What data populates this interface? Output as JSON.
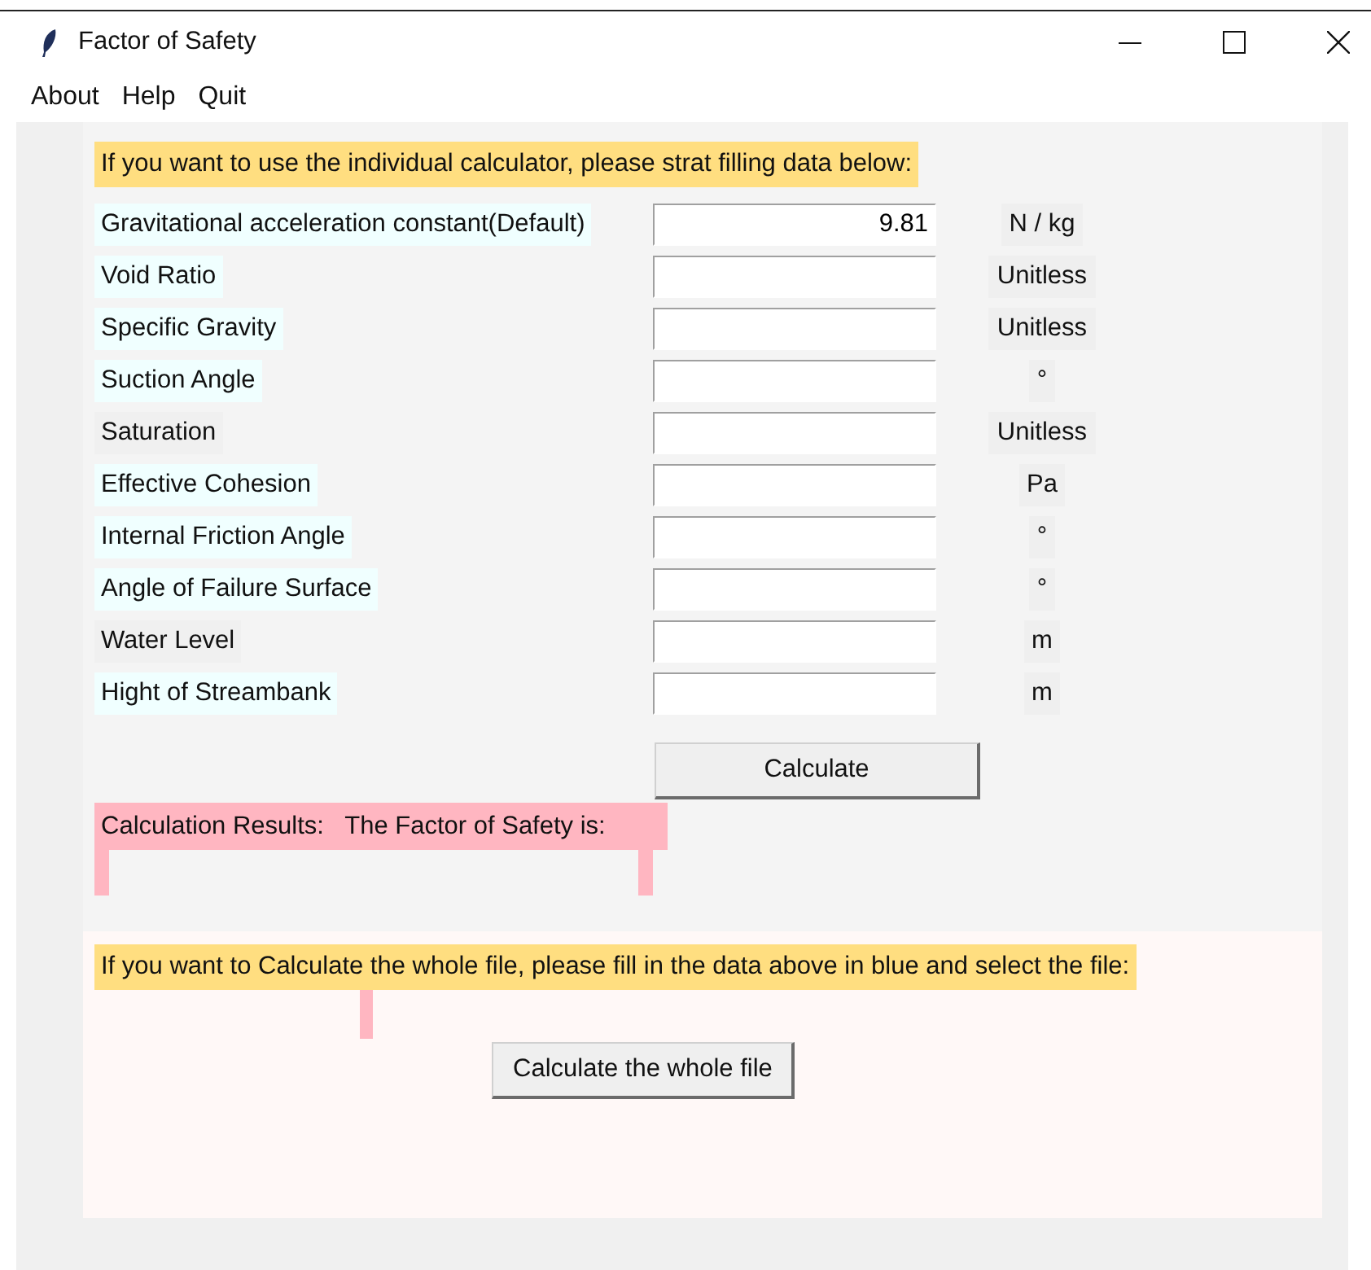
{
  "window": {
    "title": "Factor of Safety"
  },
  "menu": [
    "About",
    "Help",
    "Quit"
  ],
  "intro": "If you want to use the individual calculator, please strat filling data below:",
  "fields": [
    {
      "label": "Gravitational acceleration constant(Default)",
      "value": "9.81",
      "unit": "N / kg",
      "color": "#f0ffff"
    },
    {
      "label": "Void Ratio",
      "unit": "Unitless",
      "color": "#f0ffff"
    },
    {
      "label": "Specific Gravity",
      "unit": "Unitless",
      "color": "#f0ffff"
    },
    {
      "label": "Suction Angle",
      "unit": "°",
      "color": "#f0ffff"
    },
    {
      "label": "Saturation",
      "unit": "Unitless",
      "color": "#f0f0f0"
    },
    {
      "label": "Effective Cohesion",
      "unit": "Pa",
      "color": "#f0ffff"
    },
    {
      "label": "Internal Friction Angle",
      "unit": "°",
      "color": "#f0ffff"
    },
    {
      "label": "Angle of Failure Surface",
      "unit": "°",
      "color": "#f0ffff"
    },
    {
      "label": "Water Level",
      "unit": "m",
      "color": "#f0f0f0"
    },
    {
      "label": "Hight of Streambank",
      "unit": "m",
      "color": "#f0ffff"
    }
  ],
  "calculate_button": "Calculate",
  "result_label": "Calculation Results:   The Factor of Safety is:",
  "file_prompt": "If you want to Calculate the whole file, please fill in the data above in blue and select the file:",
  "file_button": "Calculate the whole file"
}
